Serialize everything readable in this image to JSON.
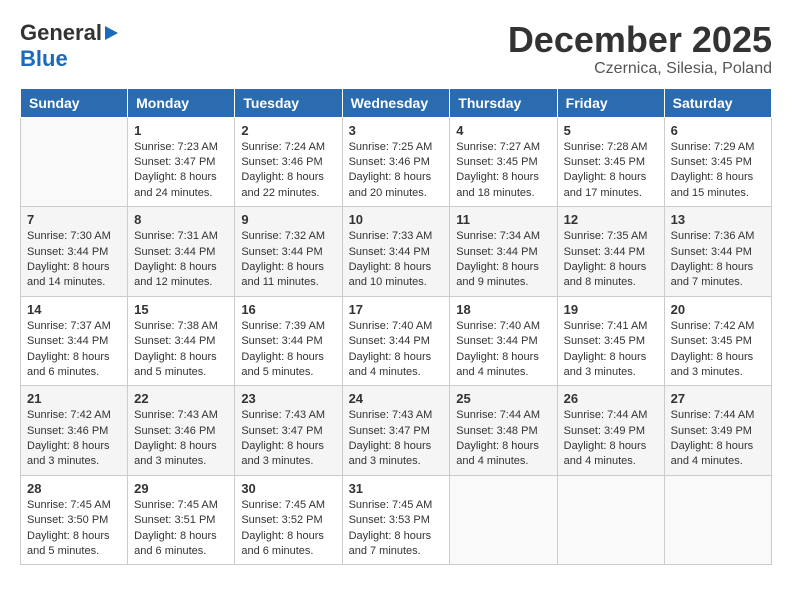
{
  "header": {
    "logo_general": "General",
    "logo_blue": "Blue",
    "month_title": "December 2025",
    "location": "Czernica, Silesia, Poland"
  },
  "columns": [
    "Sunday",
    "Monday",
    "Tuesday",
    "Wednesday",
    "Thursday",
    "Friday",
    "Saturday"
  ],
  "weeks": [
    [
      {
        "day": "",
        "info": ""
      },
      {
        "day": "1",
        "info": "Sunrise: 7:23 AM\nSunset: 3:47 PM\nDaylight: 8 hours\nand 24 minutes."
      },
      {
        "day": "2",
        "info": "Sunrise: 7:24 AM\nSunset: 3:46 PM\nDaylight: 8 hours\nand 22 minutes."
      },
      {
        "day": "3",
        "info": "Sunrise: 7:25 AM\nSunset: 3:46 PM\nDaylight: 8 hours\nand 20 minutes."
      },
      {
        "day": "4",
        "info": "Sunrise: 7:27 AM\nSunset: 3:45 PM\nDaylight: 8 hours\nand 18 minutes."
      },
      {
        "day": "5",
        "info": "Sunrise: 7:28 AM\nSunset: 3:45 PM\nDaylight: 8 hours\nand 17 minutes."
      },
      {
        "day": "6",
        "info": "Sunrise: 7:29 AM\nSunset: 3:45 PM\nDaylight: 8 hours\nand 15 minutes."
      }
    ],
    [
      {
        "day": "7",
        "info": "Sunrise: 7:30 AM\nSunset: 3:44 PM\nDaylight: 8 hours\nand 14 minutes."
      },
      {
        "day": "8",
        "info": "Sunrise: 7:31 AM\nSunset: 3:44 PM\nDaylight: 8 hours\nand 12 minutes."
      },
      {
        "day": "9",
        "info": "Sunrise: 7:32 AM\nSunset: 3:44 PM\nDaylight: 8 hours\nand 11 minutes."
      },
      {
        "day": "10",
        "info": "Sunrise: 7:33 AM\nSunset: 3:44 PM\nDaylight: 8 hours\nand 10 minutes."
      },
      {
        "day": "11",
        "info": "Sunrise: 7:34 AM\nSunset: 3:44 PM\nDaylight: 8 hours\nand 9 minutes."
      },
      {
        "day": "12",
        "info": "Sunrise: 7:35 AM\nSunset: 3:44 PM\nDaylight: 8 hours\nand 8 minutes."
      },
      {
        "day": "13",
        "info": "Sunrise: 7:36 AM\nSunset: 3:44 PM\nDaylight: 8 hours\nand 7 minutes."
      }
    ],
    [
      {
        "day": "14",
        "info": "Sunrise: 7:37 AM\nSunset: 3:44 PM\nDaylight: 8 hours\nand 6 minutes."
      },
      {
        "day": "15",
        "info": "Sunrise: 7:38 AM\nSunset: 3:44 PM\nDaylight: 8 hours\nand 5 minutes."
      },
      {
        "day": "16",
        "info": "Sunrise: 7:39 AM\nSunset: 3:44 PM\nDaylight: 8 hours\nand 5 minutes."
      },
      {
        "day": "17",
        "info": "Sunrise: 7:40 AM\nSunset: 3:44 PM\nDaylight: 8 hours\nand 4 minutes."
      },
      {
        "day": "18",
        "info": "Sunrise: 7:40 AM\nSunset: 3:44 PM\nDaylight: 8 hours\nand 4 minutes."
      },
      {
        "day": "19",
        "info": "Sunrise: 7:41 AM\nSunset: 3:45 PM\nDaylight: 8 hours\nand 3 minutes."
      },
      {
        "day": "20",
        "info": "Sunrise: 7:42 AM\nSunset: 3:45 PM\nDaylight: 8 hours\nand 3 minutes."
      }
    ],
    [
      {
        "day": "21",
        "info": "Sunrise: 7:42 AM\nSunset: 3:46 PM\nDaylight: 8 hours\nand 3 minutes."
      },
      {
        "day": "22",
        "info": "Sunrise: 7:43 AM\nSunset: 3:46 PM\nDaylight: 8 hours\nand 3 minutes."
      },
      {
        "day": "23",
        "info": "Sunrise: 7:43 AM\nSunset: 3:47 PM\nDaylight: 8 hours\nand 3 minutes."
      },
      {
        "day": "24",
        "info": "Sunrise: 7:43 AM\nSunset: 3:47 PM\nDaylight: 8 hours\nand 3 minutes."
      },
      {
        "day": "25",
        "info": "Sunrise: 7:44 AM\nSunset: 3:48 PM\nDaylight: 8 hours\nand 4 minutes."
      },
      {
        "day": "26",
        "info": "Sunrise: 7:44 AM\nSunset: 3:49 PM\nDaylight: 8 hours\nand 4 minutes."
      },
      {
        "day": "27",
        "info": "Sunrise: 7:44 AM\nSunset: 3:49 PM\nDaylight: 8 hours\nand 4 minutes."
      }
    ],
    [
      {
        "day": "28",
        "info": "Sunrise: 7:45 AM\nSunset: 3:50 PM\nDaylight: 8 hours\nand 5 minutes."
      },
      {
        "day": "29",
        "info": "Sunrise: 7:45 AM\nSunset: 3:51 PM\nDaylight: 8 hours\nand 6 minutes."
      },
      {
        "day": "30",
        "info": "Sunrise: 7:45 AM\nSunset: 3:52 PM\nDaylight: 8 hours\nand 6 minutes."
      },
      {
        "day": "31",
        "info": "Sunrise: 7:45 AM\nSunset: 3:53 PM\nDaylight: 8 hours\nand 7 minutes."
      },
      {
        "day": "",
        "info": ""
      },
      {
        "day": "",
        "info": ""
      },
      {
        "day": "",
        "info": ""
      }
    ]
  ]
}
